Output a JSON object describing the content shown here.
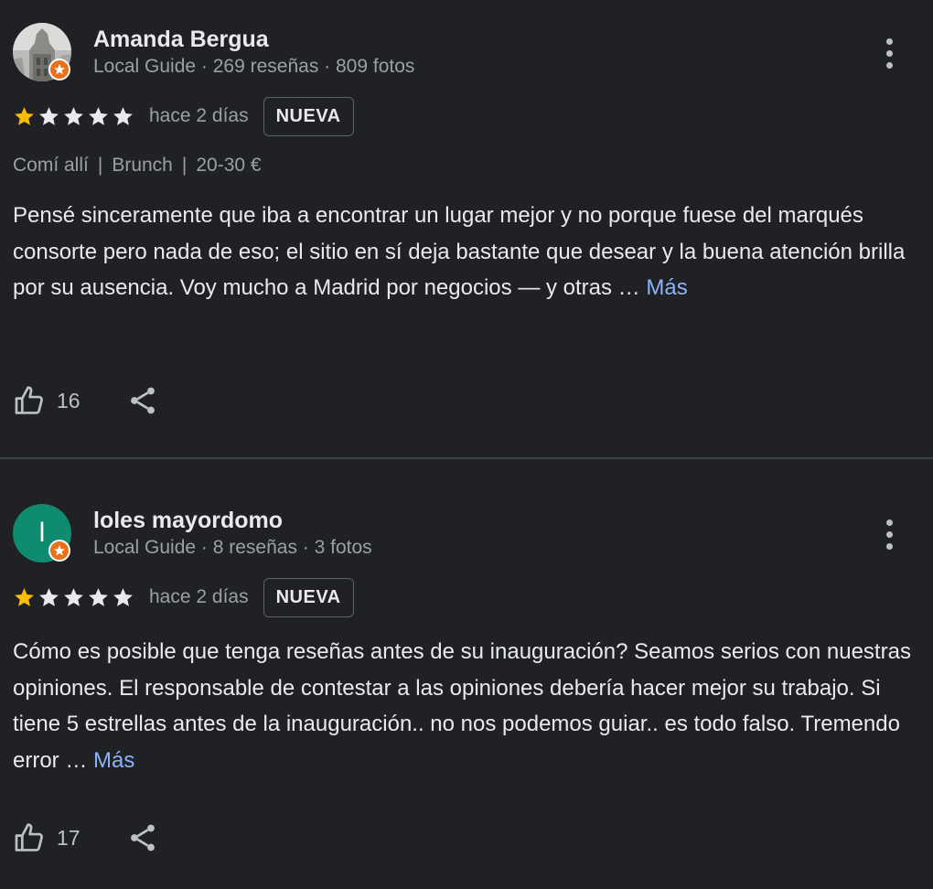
{
  "colors": {
    "background": "#202124",
    "star_filled": "#fbbc04",
    "star_empty": "#e8eaed",
    "link": "#8ab4f8",
    "guide_badge": "#e8711c",
    "avatar_letter_bg": "#0f8b6f"
  },
  "reviews": [
    {
      "author": "Amanda Bergua",
      "avatar": {
        "type": "photo",
        "icon": "building-photo"
      },
      "meta": "Local Guide · 269 reseñas · 809 fotos",
      "rating": 1,
      "max_rating": 5,
      "time": "hace 2 días",
      "badge": "NUEVA",
      "attributes": [
        "Comí allí",
        "Brunch",
        "20-30 €"
      ],
      "text": "Pensé sinceramente que iba a encontrar un lugar mejor y no porque fuese del marqués consorte pero nada de eso; el sitio en sí deja bastante que desear y la buena atención brilla por su ausencia. Voy mucho a Madrid por negocios — y otras …",
      "more_label": "Más",
      "likes": "16"
    },
    {
      "author": "loles mayordomo",
      "avatar": {
        "type": "letter",
        "letter": "l"
      },
      "meta": "Local Guide · 8 reseñas · 3 fotos",
      "rating": 1,
      "max_rating": 5,
      "time": "hace 2 días",
      "badge": "NUEVA",
      "text": "Cómo es posible que tenga reseñas antes de su inauguración? Seamos serios con nuestras opiniones. El responsable de contestar a las opiniones debería hacer mejor su trabajo. Si tiene 5 estrellas antes de la inauguración.. no nos podemos guiar.. es todo falso. Tremendo error …",
      "more_label": "Más",
      "likes": "17"
    }
  ]
}
